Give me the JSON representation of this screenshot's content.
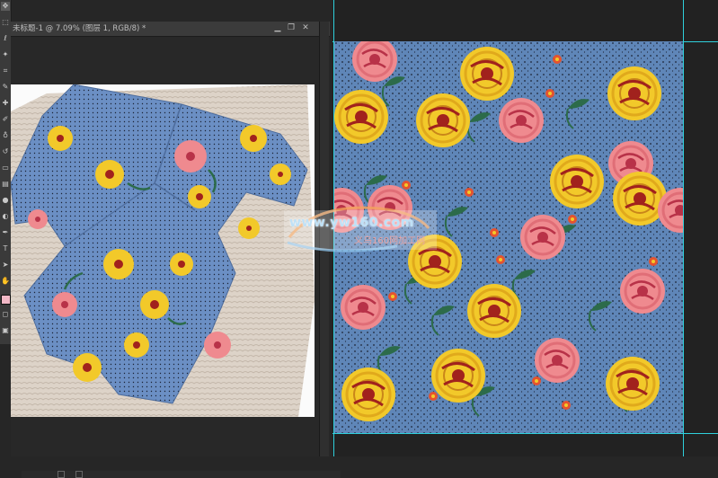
{
  "document": {
    "title": "未标题-1 @ 7.09% (图层 1, RGB/8) *",
    "controls": [
      "minimize",
      "restore",
      "close"
    ]
  },
  "toolbar": {
    "tools": [
      "move-tool",
      "marquee-tool",
      "lasso-tool",
      "magic-wand-tool",
      "crop-tool",
      "eyedropper-tool",
      "healing-brush-tool",
      "brush-tool",
      "clone-stamp-tool",
      "history-brush-tool",
      "eraser-tool",
      "gradient-tool",
      "blur-tool",
      "dodge-tool",
      "pen-tool",
      "type-tool",
      "path-selection-tool",
      "shape-tool",
      "hand-tool",
      "zoom-tool"
    ],
    "foreground_color": "#f2b8c6"
  },
  "watermark": {
    "text": "www.yw160.com",
    "sub": "义乌160网加工网"
  },
  "colors": {
    "fabric": "#6b8fc4",
    "pattern_bg": "#5f86b8",
    "dot": "#1c2436",
    "yellow_flower": "#f2c92a",
    "yellow_center": "#a1221d",
    "pink_flower": "#ef8a8f",
    "pink_center": "#b83248",
    "leaf": "#2c6b4a",
    "guide": "#2fd1dc"
  }
}
